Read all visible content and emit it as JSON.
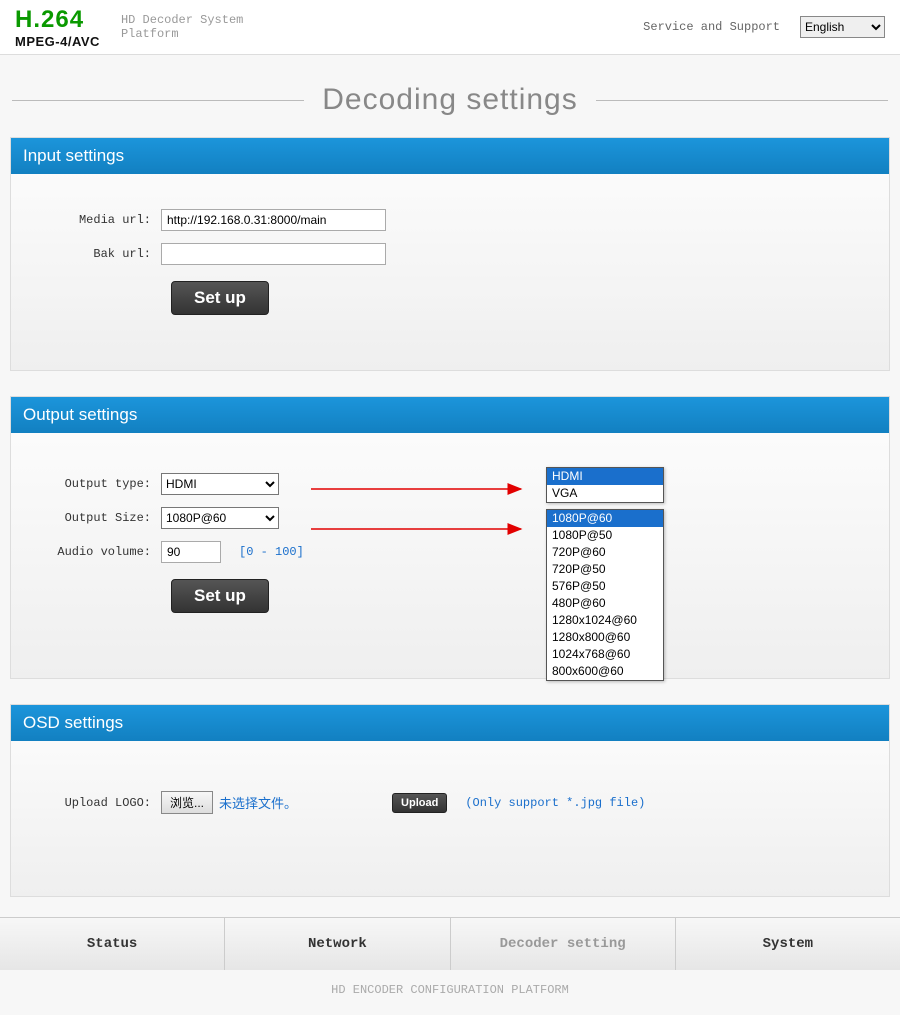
{
  "header": {
    "logo_line1": "H.264",
    "logo_line2": "MPEG-4/AVC",
    "logo_desc_line1": "HD Decoder System",
    "logo_desc_line2": "Platform",
    "service_link": "Service and Support",
    "language": "English"
  },
  "page_title": "Decoding  settings",
  "input_settings": {
    "title": "Input settings",
    "media_url_label": "Media url:",
    "media_url_value": "http://192.168.0.31:8000/main",
    "bak_url_label": "Bak url:",
    "bak_url_value": "",
    "setup_label": "Set up"
  },
  "output_settings": {
    "title": "Output settings",
    "output_type_label": "Output type:",
    "output_type_value": "HDMI",
    "output_type_options": [
      "HDMI",
      "VGA"
    ],
    "output_size_label": "Output Size:",
    "output_size_value": "1080P@60",
    "output_size_options": [
      "1080P@60",
      "1080P@50",
      "720P@60",
      "720P@50",
      "576P@50",
      "480P@60",
      "1280x1024@60",
      "1280x800@60",
      "1024x768@60",
      "800x600@60"
    ],
    "audio_volume_label": "Audio volume:",
    "audio_volume_value": "90",
    "audio_volume_hint": "[0 - 100]",
    "setup_label": "Set up"
  },
  "osd_settings": {
    "title": "OSD settings",
    "upload_logo_label": "Upload LOGO:",
    "browse_label": "浏览...",
    "no_file_text": "未选择文件。",
    "upload_button_label": "Upload",
    "upload_hint": "(Only support *.jpg file)"
  },
  "nav": {
    "status": "Status",
    "network": "Network",
    "decoder": "Decoder setting",
    "system": "System"
  },
  "footer": "HD ENCODER CONFIGURATION PLATFORM"
}
